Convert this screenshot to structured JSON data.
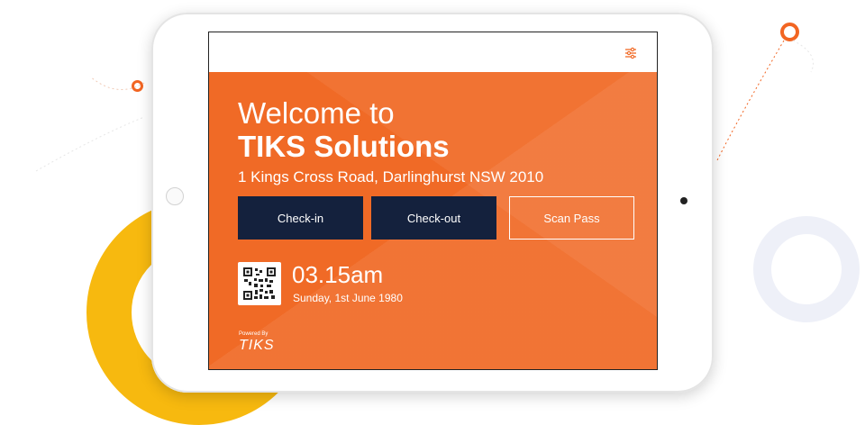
{
  "welcome": {
    "line1": "Welcome to",
    "company": "TIKS Solutions",
    "address": "1 Kings Cross Road, Darlinghurst NSW 2010"
  },
  "actions": {
    "checkin": "Check-in",
    "checkout": "Check-out",
    "scan_pass": "Scan Pass"
  },
  "clock": {
    "time": "03.15am",
    "date": "Sunday, 1st June 1980"
  },
  "footer": {
    "powered_by": "Powered By",
    "brand": "TIKS"
  },
  "icons": {
    "settings": "sliders-icon",
    "qr": "qr-code-icon"
  },
  "colors": {
    "accent": "#f06a26",
    "button_dark": "#14213d",
    "ring_yellow": "#f7b90f"
  }
}
